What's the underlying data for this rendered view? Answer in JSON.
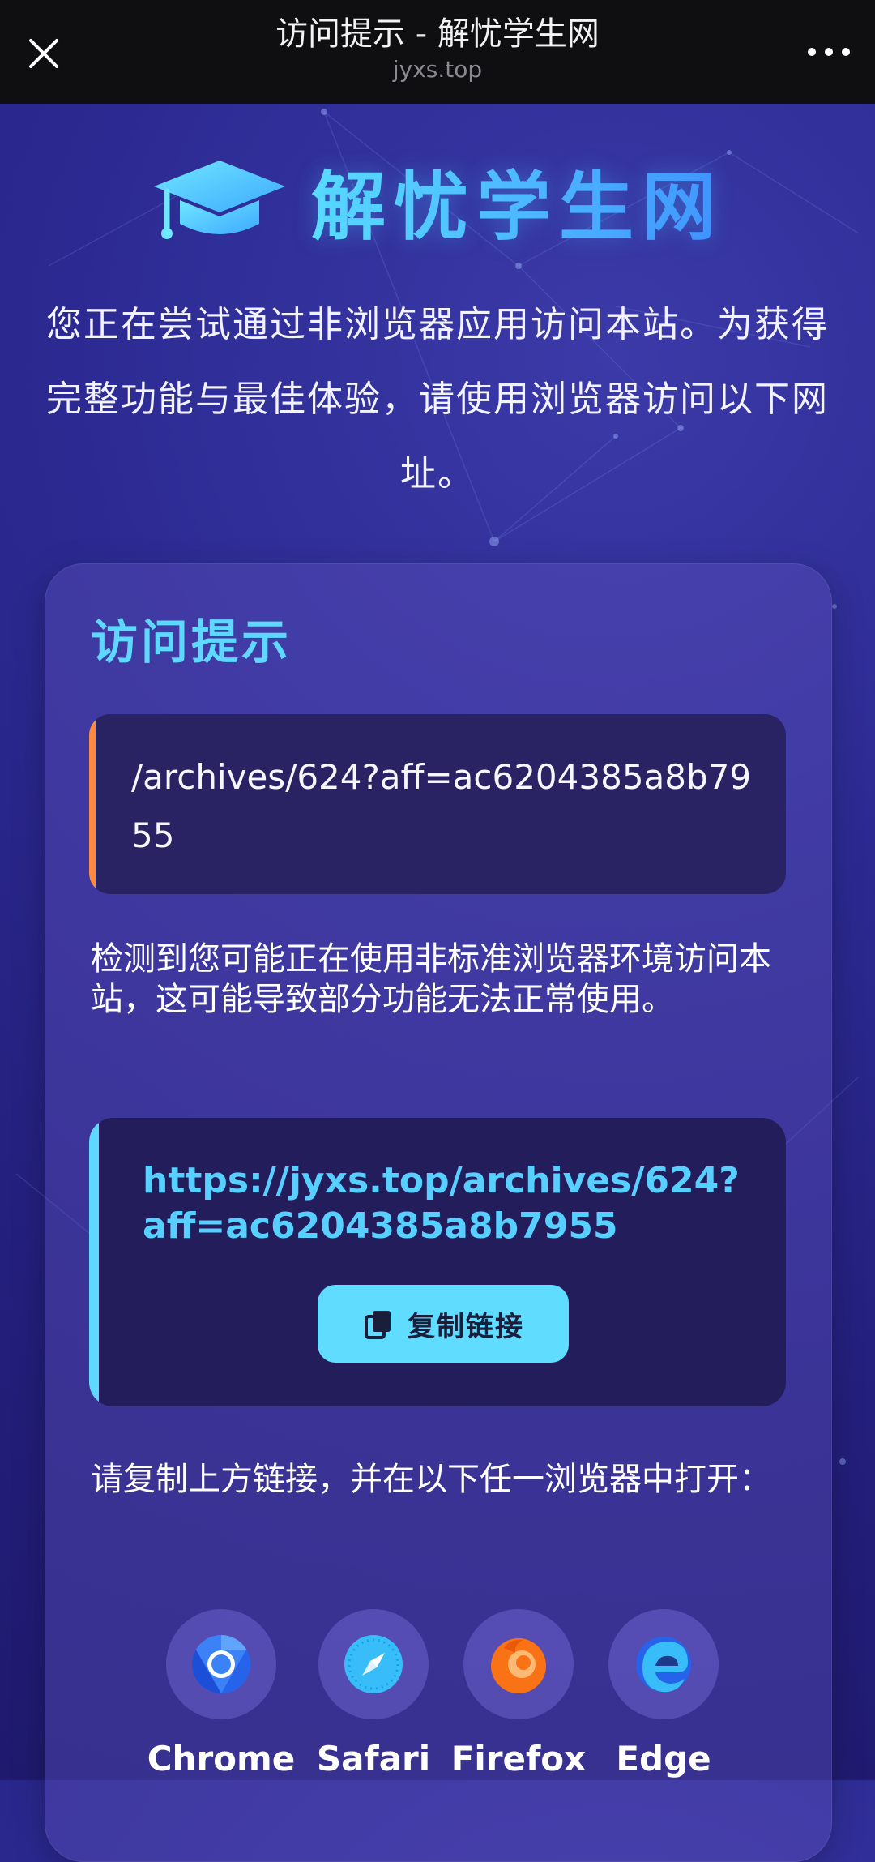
{
  "topbar": {
    "title": "访问提示 - 解忧学生网",
    "domain": "jyxs.top"
  },
  "brand": {
    "name": "解忧学生网",
    "accent_color": "#5de2ff"
  },
  "intro": {
    "text": "您正在尝试通过非浏览器应用访问本站。为获得完整功能与最佳体验，请使用浏览器访问以下网址。"
  },
  "card": {
    "title": "访问提示",
    "path": "/archives/624?aff=ac6204385a8b7955",
    "detect_text": "检测到您可能正在使用非标准浏览器环境访问本站，这可能导致部分功能无法正常使用。",
    "url": "https://jyxs.top/archives/624?aff=ac6204385a8b7955",
    "copy_label": "复制链接",
    "instruct_text": "请复制上方链接，并在以下任一浏览器中打开："
  },
  "browsers": [
    {
      "name": "Chrome",
      "icon": "chrome-icon"
    },
    {
      "name": "Safari",
      "icon": "safari-icon"
    },
    {
      "name": "Firefox",
      "icon": "firefox-icon"
    },
    {
      "name": "Edge",
      "icon": "edge-icon"
    }
  ],
  "colors": {
    "path_accent": "#ff8a3d",
    "url_accent": "#5fd8ff",
    "button_bg": "#5fdcff"
  }
}
